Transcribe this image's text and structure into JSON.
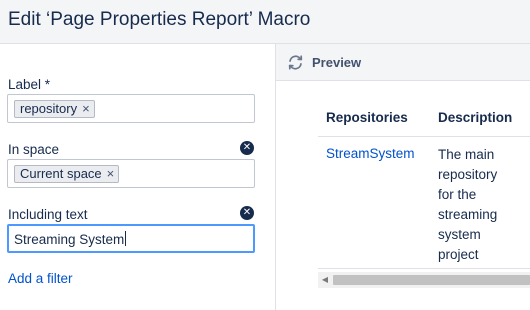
{
  "dialog": {
    "title": "Edit ‘Page Properties Report’ Macro"
  },
  "form": {
    "label_field": {
      "label": "Label *",
      "chips": [
        "repository"
      ]
    },
    "space_field": {
      "label": "In space",
      "chips": [
        "Current space"
      ]
    },
    "text_field": {
      "label": "Including text",
      "value": "Streaming System"
    },
    "add_filter_link": "Add a filter",
    "chip_remove_glyph": "×",
    "clear_glyph": "✕"
  },
  "preview": {
    "label": "Preview",
    "icon": "refresh-icon",
    "table": {
      "columns": [
        "Repositories",
        "Description"
      ],
      "rows": [
        {
          "link": "StreamSystem",
          "description_lines": [
            "The main",
            "repository",
            "for the",
            "streaming",
            "system",
            "project"
          ]
        }
      ]
    },
    "scroll_left_glyph": "◀"
  },
  "colors": {
    "link": "#0052cc",
    "focus_border": "#4c9aff",
    "text": "#172b4d"
  }
}
